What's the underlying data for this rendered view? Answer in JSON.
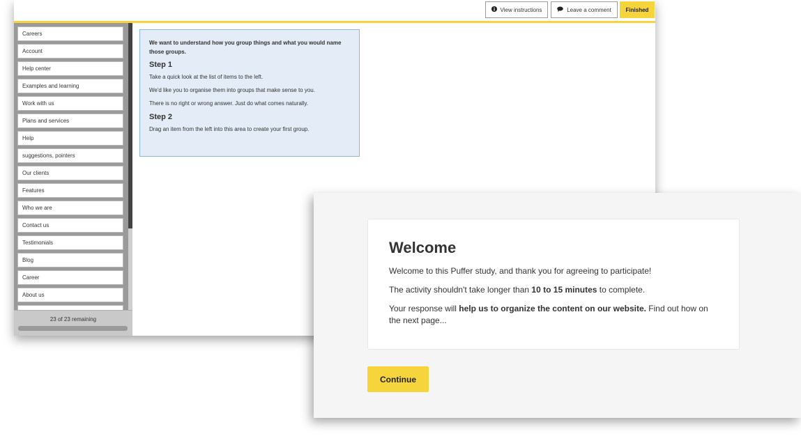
{
  "toolbar": {
    "view_instructions": "View instructions",
    "leave_comment": "Leave a comment",
    "finished": "Finished"
  },
  "sidebar": {
    "cards": [
      "Careers",
      "Account",
      "Help center",
      "Examples and learning",
      "Work with us",
      "Plans and services",
      "Help",
      "suggestions, pointers",
      "Our clients",
      "Features",
      "Who we are",
      "Contact us",
      "Testimonials",
      "Blog",
      "Career",
      "About us",
      ""
    ],
    "remaining_text": "23 of 23 remaining",
    "progress_fraction": 1.0
  },
  "instructions": {
    "lead": "We want to understand how you group things and what you would name those groups.",
    "step1_title": "Step 1",
    "step1_line1": "Take a quick look at the list of items to the left.",
    "step1_line2": "We'd like you to organise them into groups that make sense to you.",
    "step1_line3": "There is no right or wrong answer. Just do what comes naturally.",
    "step2_title": "Step 2",
    "step2_line1": "Drag an item from the left into this area to create your first group."
  },
  "welcome": {
    "title": "Welcome",
    "line1": "Welcome to this Puffer study, and thank you for agreeing to participate!",
    "line2_pre": "The activity shouldn't take longer than ",
    "line2_bold": "10 to 15 minutes",
    "line2_post": " to complete.",
    "line3_pre": "Your response will ",
    "line3_bold": "help us to organize the content on our website.",
    "line3_post": " Find out how on the next page...",
    "continue_label": "Continue"
  },
  "colors": {
    "accent": "#f6d43c",
    "sidebar_bg": "#9a9a9a",
    "instructions_bg": "#e3ecf7"
  },
  "icons": {
    "view_instructions": "info-circle-icon",
    "leave_comment": "comment-icon"
  }
}
